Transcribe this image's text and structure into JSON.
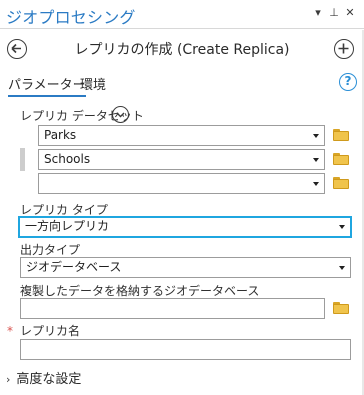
{
  "titlebar": {
    "title": "ジオプロセシング",
    "menu_glyph": "▾",
    "pin_glyph": "⊥",
    "close_glyph": "✕"
  },
  "header": {
    "back_glyph": "←",
    "title": "レプリカの作成 (Create Replica)",
    "add_glyph": "+"
  },
  "tabs": {
    "parameters": "パラメーター",
    "environments": "環境",
    "help_glyph": "?"
  },
  "datasets": {
    "label": "レプリカ データセット",
    "items": [
      "Parks",
      "Schools",
      ""
    ]
  },
  "replica_type": {
    "label": "レプリカ タイプ",
    "value": "一方向レプリカ"
  },
  "output_type": {
    "label": "出力タイプ",
    "value": "ジオデータベース"
  },
  "geodatabase": {
    "label": "複製したデータを格納するジオデータベース",
    "value": ""
  },
  "replica_name": {
    "required_mark": "*",
    "label": "レプリカ名",
    "value": ""
  },
  "advanced": {
    "chevron": "›",
    "label": "高度な設定"
  },
  "colors": {
    "accent": "#2b7bc4",
    "selection": "#1fa6e0",
    "folder": "#f0c44c",
    "required": "#d9534f"
  }
}
